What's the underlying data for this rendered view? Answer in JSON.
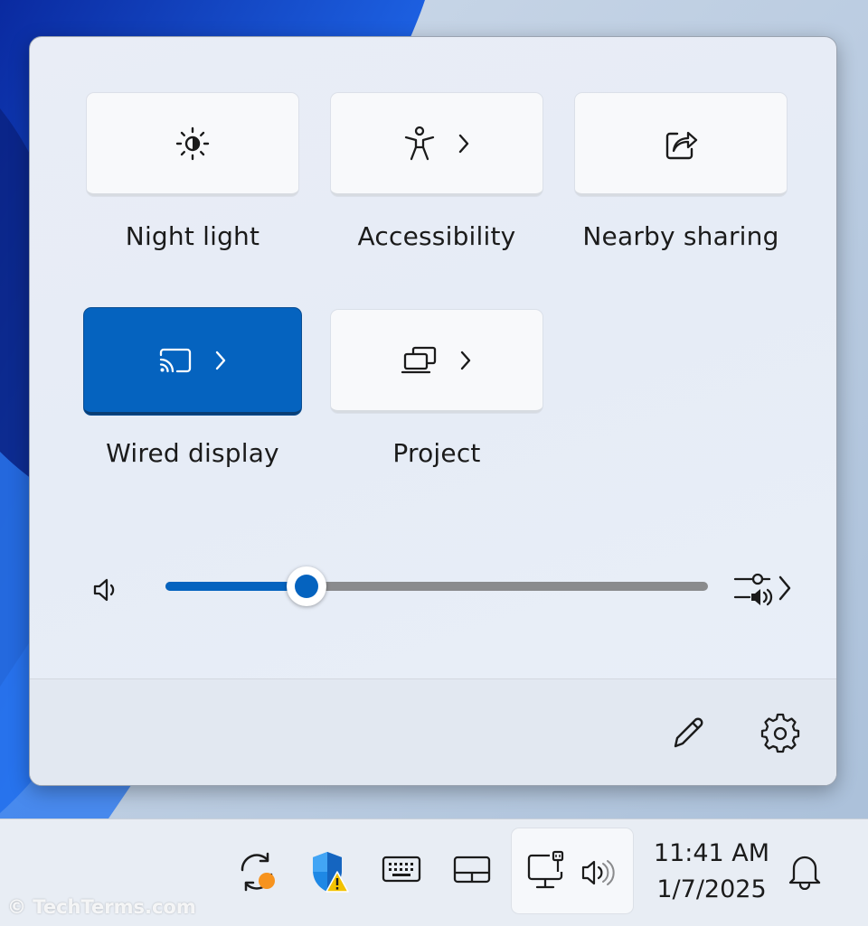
{
  "tiles": [
    {
      "label": "Night light",
      "icon": "sun-icon",
      "active": false,
      "expandable": false
    },
    {
      "label": "Accessibility",
      "icon": "accessibility-icon",
      "active": false,
      "expandable": true
    },
    {
      "label": "Nearby sharing",
      "icon": "share-icon",
      "active": false,
      "expandable": false
    },
    {
      "label": "Wired display",
      "icon": "cast-icon",
      "active": true,
      "expandable": true
    },
    {
      "label": "Project",
      "icon": "project-icon",
      "active": false,
      "expandable": true
    }
  ],
  "volume": {
    "level_percent": 26
  },
  "clock": {
    "time": "11:41 AM",
    "date": "1/7/2025"
  },
  "watermark": "© TechTerms.com",
  "colors": {
    "accent": "#0563bf",
    "warning": "#f2c200",
    "update_badge": "#f7931e",
    "shield": "#1e88e5"
  }
}
